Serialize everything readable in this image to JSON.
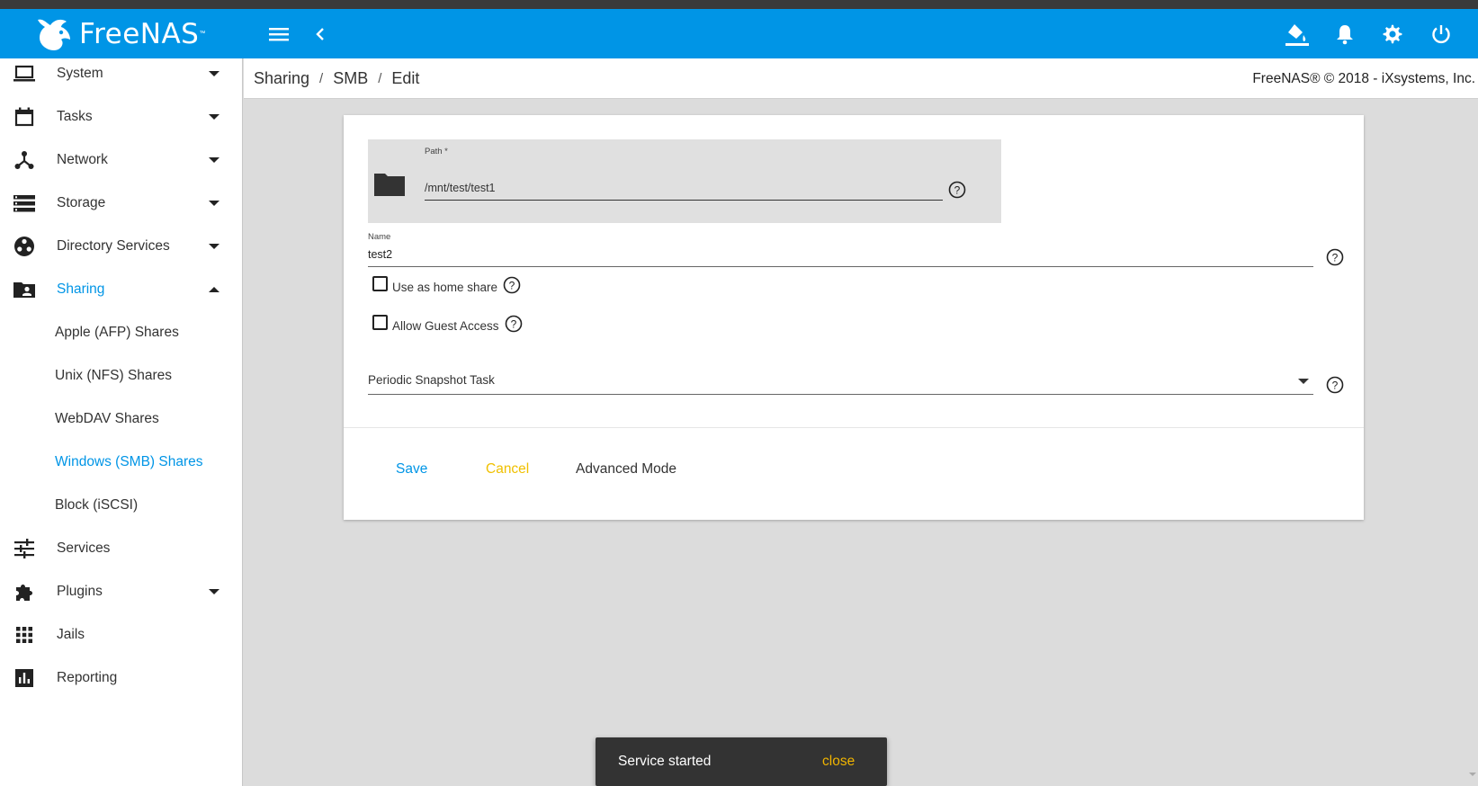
{
  "app": {
    "name": "FreeNAS",
    "trademark": "™"
  },
  "topbar": {
    "menu_icon": "menu-icon",
    "back_icon": "chevron-left-icon",
    "actions": [
      "theme-icon",
      "bell-icon",
      "gear-icon",
      "power-icon"
    ]
  },
  "sidebar": {
    "items": [
      {
        "label": "System",
        "icon": "laptop-icon",
        "expandable": true,
        "expanded": false
      },
      {
        "label": "Tasks",
        "icon": "calendar-icon",
        "expandable": true,
        "expanded": false
      },
      {
        "label": "Network",
        "icon": "network-icon",
        "expandable": true,
        "expanded": false
      },
      {
        "label": "Storage",
        "icon": "storage-icon",
        "expandable": true,
        "expanded": false
      },
      {
        "label": "Directory Services",
        "icon": "directory-icon",
        "expandable": true,
        "expanded": false
      },
      {
        "label": "Sharing",
        "icon": "folder-shared-icon",
        "expandable": true,
        "expanded": true,
        "active": true
      },
      {
        "label": "Apple (AFP) Shares",
        "sub": true
      },
      {
        "label": "Unix (NFS) Shares",
        "sub": true
      },
      {
        "label": "WebDAV Shares",
        "sub": true
      },
      {
        "label": "Windows (SMB) Shares",
        "sub": true,
        "active": true
      },
      {
        "label": "Block (iSCSI)",
        "sub": true
      },
      {
        "label": "Services",
        "icon": "tune-icon",
        "expandable": false
      },
      {
        "label": "Plugins",
        "icon": "puzzle-icon",
        "expandable": true,
        "expanded": false
      },
      {
        "label": "Jails",
        "icon": "apps-grid-icon",
        "expandable": false
      },
      {
        "label": "Reporting",
        "icon": "chart-icon",
        "expandable": false
      }
    ]
  },
  "breadcrumb": {
    "items": [
      "Sharing",
      "SMB",
      "Edit"
    ],
    "separator": "/"
  },
  "copyright": "FreeNAS® © 2018 - iXsystems, Inc.",
  "form": {
    "path_label": "Path *",
    "path_value": "/mnt/test/test1",
    "name_label": "Name",
    "name_value": "test2",
    "home_share_label": "Use as home share",
    "home_share_checked": false,
    "guest_access_label": "Allow Guest Access",
    "guest_access_checked": false,
    "snapshot_task_label": "Periodic Snapshot Task",
    "save_label": "Save",
    "cancel_label": "Cancel",
    "advanced_label": "Advanced Mode"
  },
  "snackbar": {
    "message": "Service started",
    "close_label": "close"
  },
  "colors": {
    "primary": "#0095e6",
    "cancel": "#f0c000",
    "snackbar_action": "#f0b400"
  }
}
